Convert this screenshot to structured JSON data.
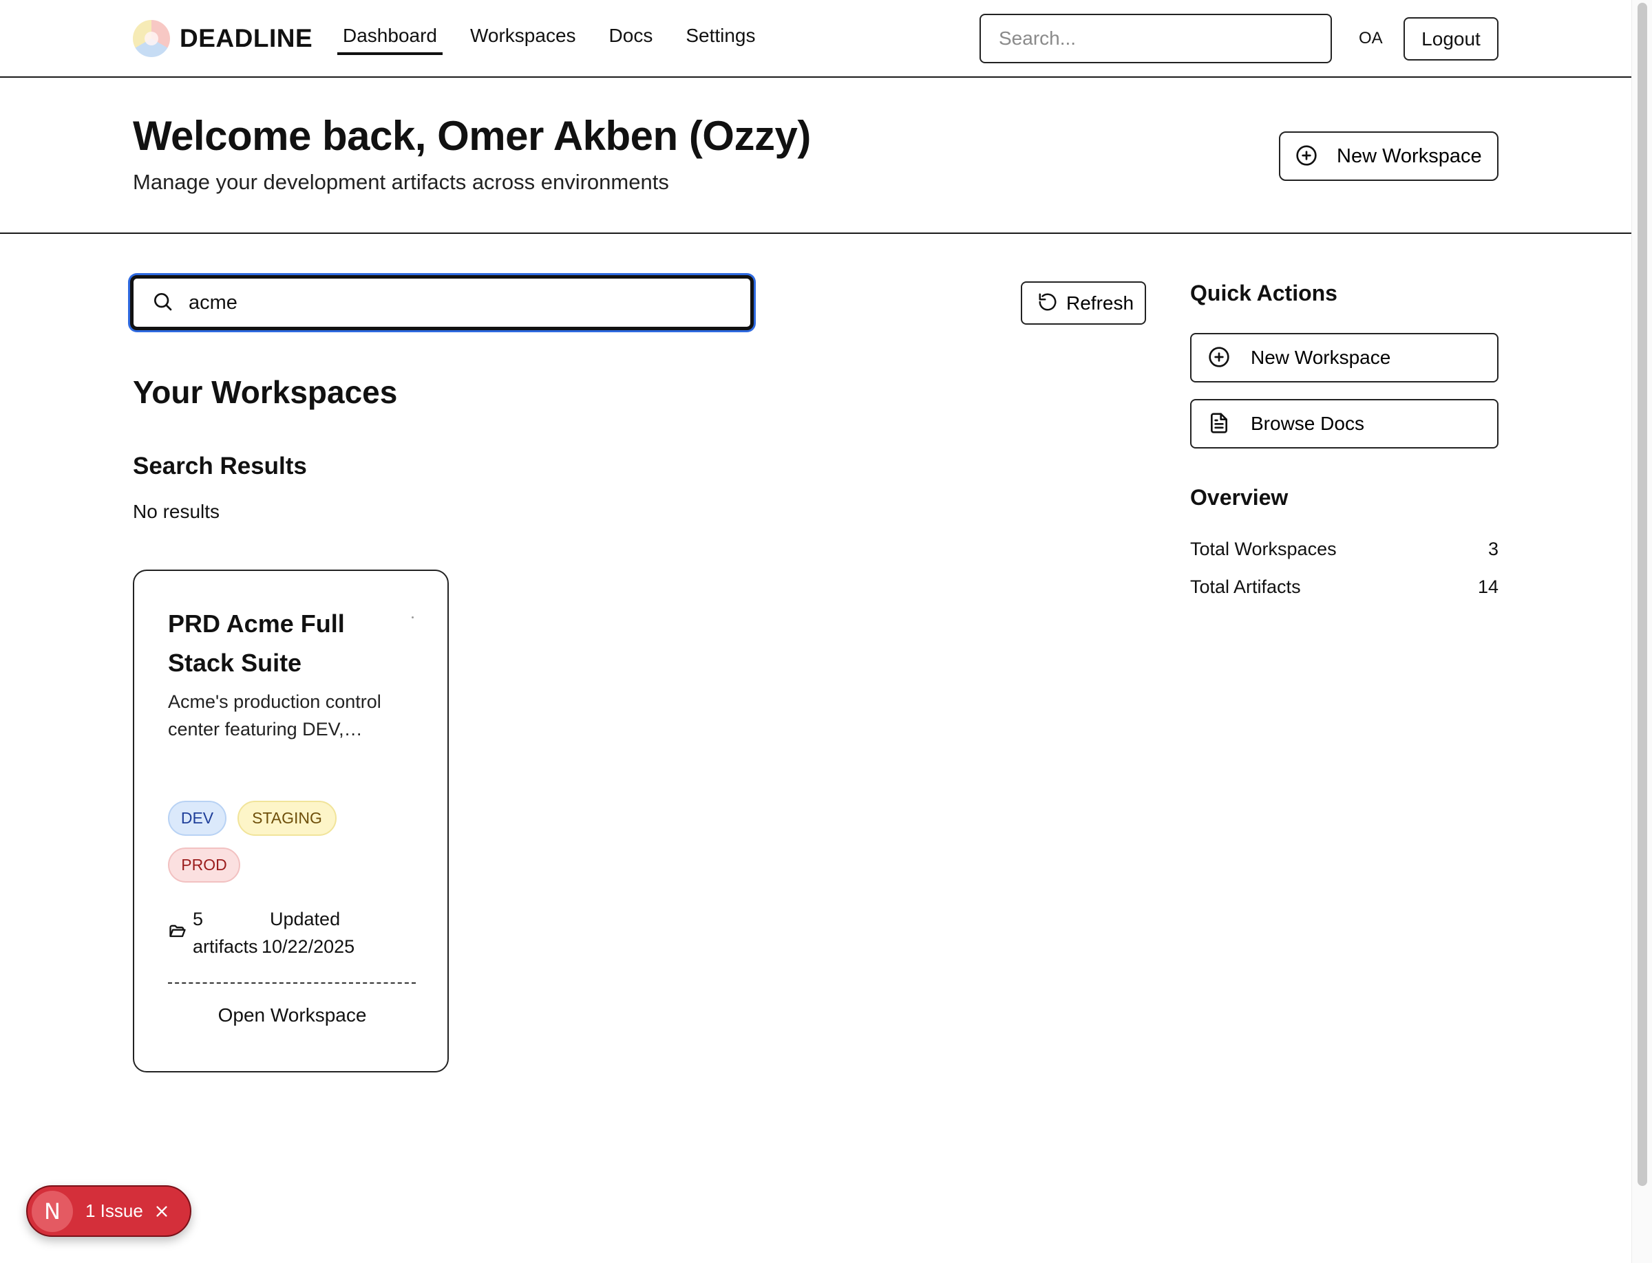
{
  "brand": {
    "name": "DEADLINE"
  },
  "nav": {
    "links": [
      {
        "label": "Dashboard",
        "active": true
      },
      {
        "label": "Workspaces",
        "active": false
      },
      {
        "label": "Docs",
        "active": false
      },
      {
        "label": "Settings",
        "active": false
      }
    ],
    "search_placeholder": "Search...",
    "user_initials": "OA",
    "logout_label": "Logout"
  },
  "header": {
    "welcome": "Welcome back, Omer Akben (Ozzy)",
    "subtitle": "Manage your development artifacts across environments",
    "new_workspace_label": "New Workspace"
  },
  "main": {
    "search_value": "acme",
    "refresh_label": "Refresh",
    "workspaces_title": "Your Workspaces",
    "search_results_title": "Search Results",
    "no_results": "No results",
    "card": {
      "title": "PRD Acme Full Stack Suite",
      "description": "Acme's production control center featuring DEV,…",
      "badges": [
        "DEV",
        "STAGING",
        "PROD"
      ],
      "artifacts_count": "5",
      "artifacts_word": "artifacts",
      "updated_word": "Updated",
      "updated_date": "10/22/2025",
      "open_label": "Open Workspace"
    }
  },
  "sidebar": {
    "quick_actions_title": "Quick Actions",
    "new_workspace_label": "New Workspace",
    "browse_docs_label": "Browse Docs",
    "overview_title": "Overview",
    "stats": [
      {
        "label": "Total Workspaces",
        "value": "3"
      },
      {
        "label": "Total Artifacts",
        "value": "14"
      }
    ]
  },
  "toast": {
    "letter": "N",
    "text": "1 Issue"
  },
  "colors": {
    "focus_ring": "#2f6ae0",
    "issue_red": "#d42f3a",
    "dev_badge": "#dbe9fb",
    "staging_badge": "#fdf5c8",
    "prod_badge": "#fbe0e0"
  },
  "icons": {
    "logo": "deadline-logo",
    "plus": "plus-circle-icon",
    "search": "search-icon",
    "refresh": "refresh-icon",
    "doc": "document-icon",
    "folder": "folder-icon",
    "close": "close-icon"
  }
}
